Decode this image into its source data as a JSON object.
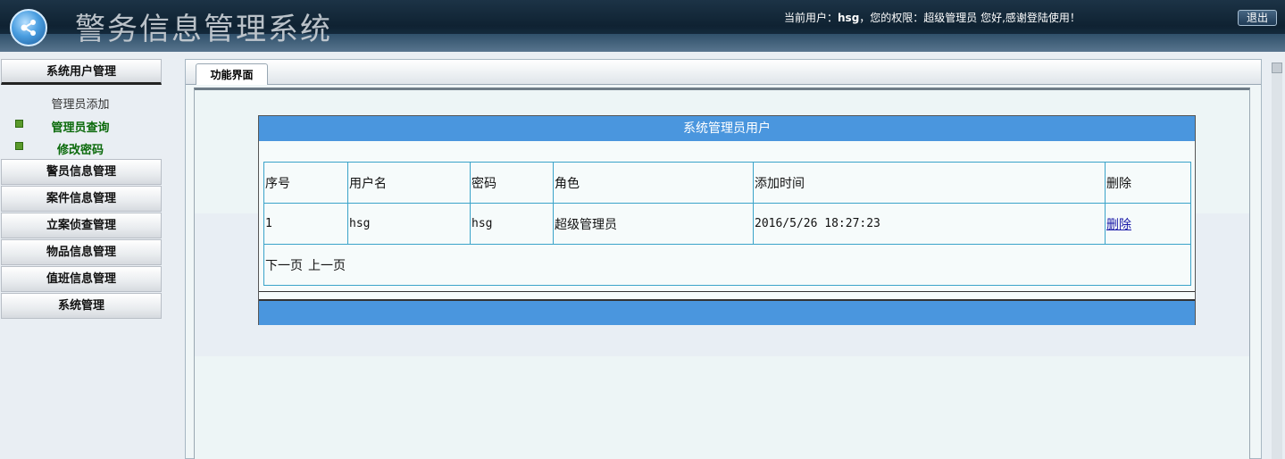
{
  "header": {
    "app_title": "警务信息管理系统",
    "user_prefix": "当前用户：",
    "username": "hsg",
    "user_middle": "，您的权限：超级管理员 您好,感谢登陆使用！",
    "logout_label": "退出"
  },
  "sidebar": {
    "menus": [
      {
        "label": "系统用户管理"
      },
      {
        "label": "警员信息管理"
      },
      {
        "label": "案件信息管理"
      },
      {
        "label": "立案侦查管理"
      },
      {
        "label": "物品信息管理"
      },
      {
        "label": "值班信息管理"
      },
      {
        "label": "系统管理"
      }
    ],
    "sub_items": [
      {
        "label": "管理员添加"
      },
      {
        "label": "管理员查询"
      },
      {
        "label": "修改密码"
      }
    ]
  },
  "main": {
    "tab_label": "功能界面",
    "box_title": "系统管理员用户",
    "columns": [
      "序号",
      "用户名",
      "密码",
      "角色",
      "添加时间",
      "删除"
    ],
    "rows": [
      {
        "index": "1",
        "username": "hsg",
        "password": "hsg",
        "role": "超级管理员",
        "added": "2016/5/26 18:27:23",
        "delete": "删除"
      }
    ],
    "pager": {
      "next": "下一页",
      "prev": "上一页"
    }
  },
  "colors": {
    "header_bg": "#0f2232",
    "box_title_bg": "#4a96de",
    "table_border": "#3aa3c9",
    "submenu_active": "#0b6a0b"
  }
}
